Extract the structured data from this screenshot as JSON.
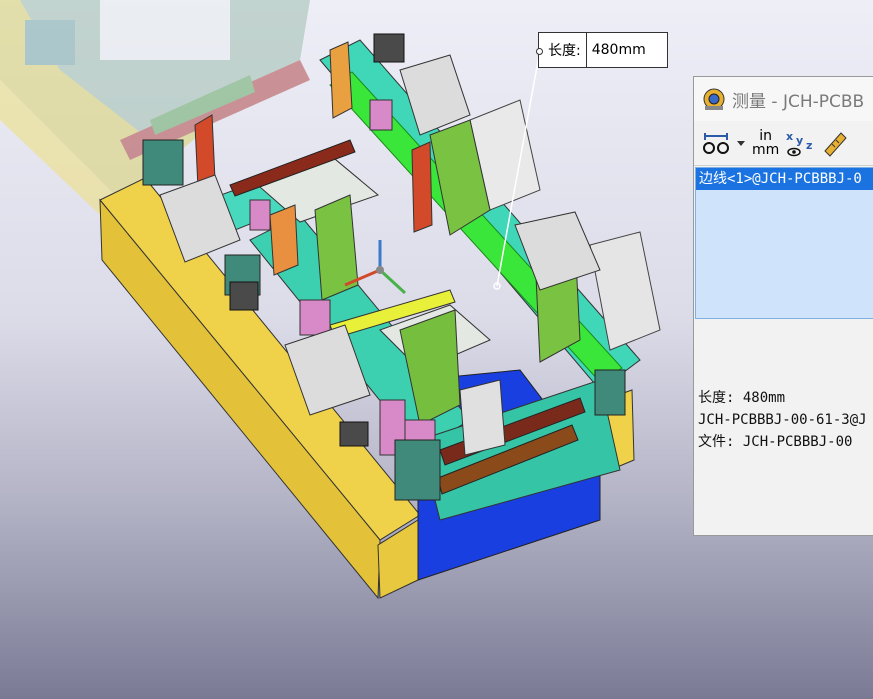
{
  "callout": {
    "label": "长度:",
    "value": "480mm"
  },
  "panel": {
    "title": "测量 - JCH-PCBB",
    "toolbar": {
      "unit_top": "in",
      "unit_bottom": "mm"
    },
    "selection": "边线<1>@JCH-PCBBBJ-0",
    "results": {
      "length": "长度: 480mm",
      "component": "JCH-PCBBBJ-00-61-3@J",
      "file": "文件:  JCH-PCBBBJ-00"
    }
  },
  "colors": {
    "base_yellow": "#f0d24a",
    "frame_cyan": "#40d6b8",
    "rail_green": "#39e639",
    "plate_green": "#7ac242",
    "plate_blue": "#1a3fe0",
    "selection_blue": "#1a73e0"
  }
}
